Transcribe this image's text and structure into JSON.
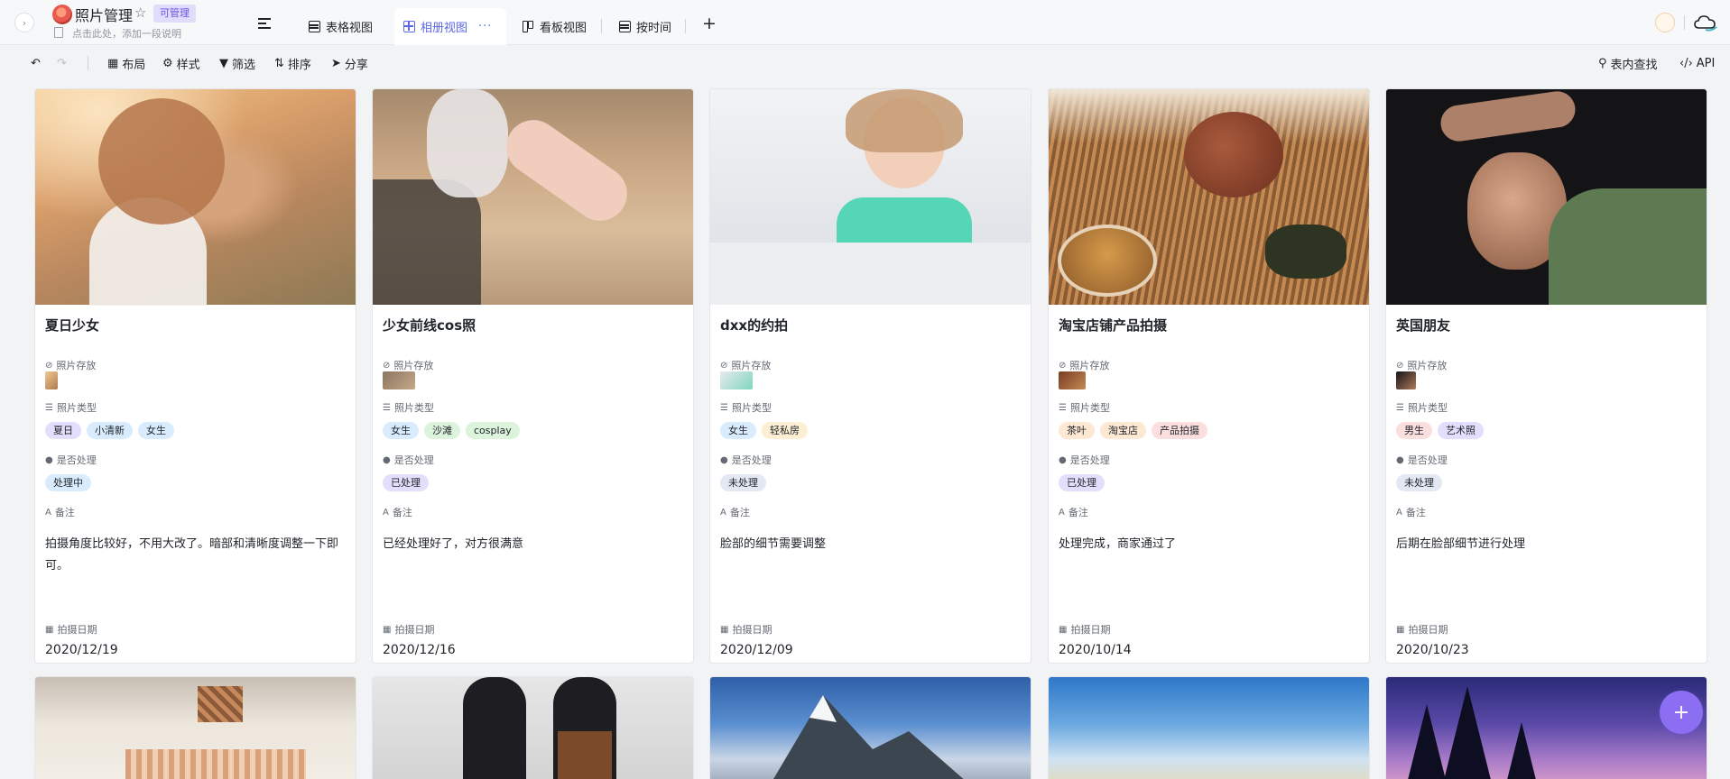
{
  "header": {
    "app_title": "照片管理",
    "permission_badge": "可管理",
    "description_placeholder": "点击此处，添加一段说明",
    "views": [
      {
        "label": "表格视图",
        "icon": "table-icon"
      },
      {
        "label": "相册视图",
        "icon": "gallery-icon",
        "active": true
      },
      {
        "label": "看板视图",
        "icon": "kanban-icon"
      },
      {
        "label": "按时间",
        "icon": "table-icon"
      }
    ],
    "more_label": "···",
    "add_view_label": "+"
  },
  "toolbar": {
    "layout_label": "布局",
    "style_label": "样式",
    "filter_label": "筛选",
    "sort_label": "排序",
    "share_label": "分享",
    "search_label": "表内查找",
    "api_label": "API"
  },
  "fields": {
    "photo_storage": "照片存放",
    "photo_type": "照片类型",
    "processed": "是否处理",
    "notes": "备注",
    "shoot_date": "拍摄日期"
  },
  "cards": [
    {
      "title": "夏日少女",
      "tags": [
        "夏日",
        "小清新",
        "女生"
      ],
      "status": "处理中",
      "note": "拍摄角度比较好，不用大改了。暗部和清晰度调整一下即可。",
      "date": "2020/12/19"
    },
    {
      "title": "少女前线cos照",
      "tags": [
        "女生",
        "沙滩",
        "cosplay"
      ],
      "status": "已处理",
      "note": "已经处理好了，对方很满意",
      "date": "2020/12/16"
    },
    {
      "title": "dxx的约拍",
      "tags": [
        "女生",
        "轻私房"
      ],
      "status": "未处理",
      "note": "脸部的细节需要调整",
      "date": "2020/12/09"
    },
    {
      "title": "淘宝店铺产品拍摄",
      "tags": [
        "茶叶",
        "淘宝店",
        "产品拍摄"
      ],
      "status": "已处理",
      "note": "处理完成，商家通过了",
      "date": "2020/10/14"
    },
    {
      "title": "英国朋友",
      "tags": [
        "男生",
        "艺术照"
      ],
      "status": "未处理",
      "note": "后期在脸部细节进行处理",
      "date": "2020/10/23"
    }
  ],
  "fab_label": "+",
  "colors": {
    "accent": "#5b67e5",
    "tag_purple": "#e3defb",
    "tag_blue": "#d9ecfd",
    "tag_green": "#dcf3dc",
    "tag_orange": "#fde8d4",
    "tag_yellow": "#fcefd4",
    "tag_red": "#fbdede"
  }
}
